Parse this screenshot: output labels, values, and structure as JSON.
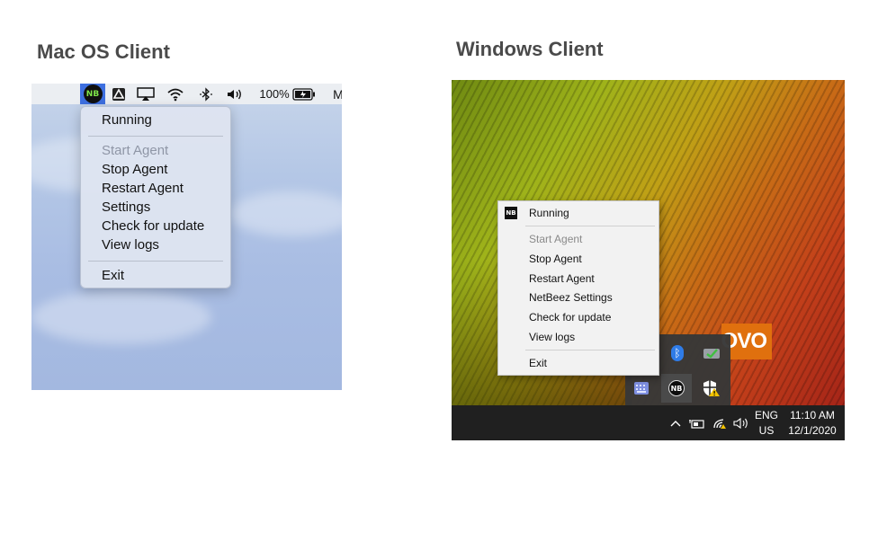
{
  "headings": {
    "mac": "Mac OS Client",
    "windows": "Windows Client"
  },
  "mac": {
    "menubar": {
      "nb_icon_text": "NB",
      "battery_text": "100%",
      "cut_off_text": "M",
      "icons": [
        "netbeez-icon",
        "google-drive-icon",
        "airplay-icon",
        "wifi-icon",
        "bluetooth-icon",
        "volume-icon",
        "battery-icon"
      ]
    },
    "menu": {
      "status": "Running",
      "items": [
        {
          "label": "Start Agent",
          "disabled": true
        },
        {
          "label": "Stop Agent",
          "disabled": false
        },
        {
          "label": "Restart Agent",
          "disabled": false
        },
        {
          "label": "Settings",
          "disabled": false
        },
        {
          "label": "Check for update",
          "disabled": false
        },
        {
          "label": "View logs",
          "disabled": false
        }
      ],
      "exit": "Exit"
    }
  },
  "windows": {
    "menu": {
      "logo_text": "NB",
      "status": "Running",
      "items": [
        {
          "label": "Start Agent",
          "disabled": true
        },
        {
          "label": "Stop Agent",
          "disabled": false
        },
        {
          "label": "Restart Agent",
          "disabled": false
        },
        {
          "label": "NetBeez Settings",
          "disabled": false
        },
        {
          "label": "Check for update",
          "disabled": false
        },
        {
          "label": "View logs",
          "disabled": false
        }
      ],
      "exit": "Exit"
    },
    "wallpaper_brand": "OVO",
    "tray": {
      "nb_icon_text": "NB",
      "icons": [
        "bluetooth-icon",
        "checkmark-drive-icon",
        "keyboard-icon",
        "netbeez-icon",
        "security-warning-icon"
      ]
    },
    "taskbar": {
      "language_line1": "ENG",
      "language_line2": "US",
      "time": "11:10 AM",
      "date": "12/1/2020",
      "icons": [
        "chevron-up-icon",
        "battery-icon",
        "wifi-icon",
        "volume-icon"
      ]
    },
    "colors": {
      "taskbar": "#202020",
      "menu_bg": "#f2f2f2",
      "lenovo_orange": "#e0700e"
    }
  }
}
